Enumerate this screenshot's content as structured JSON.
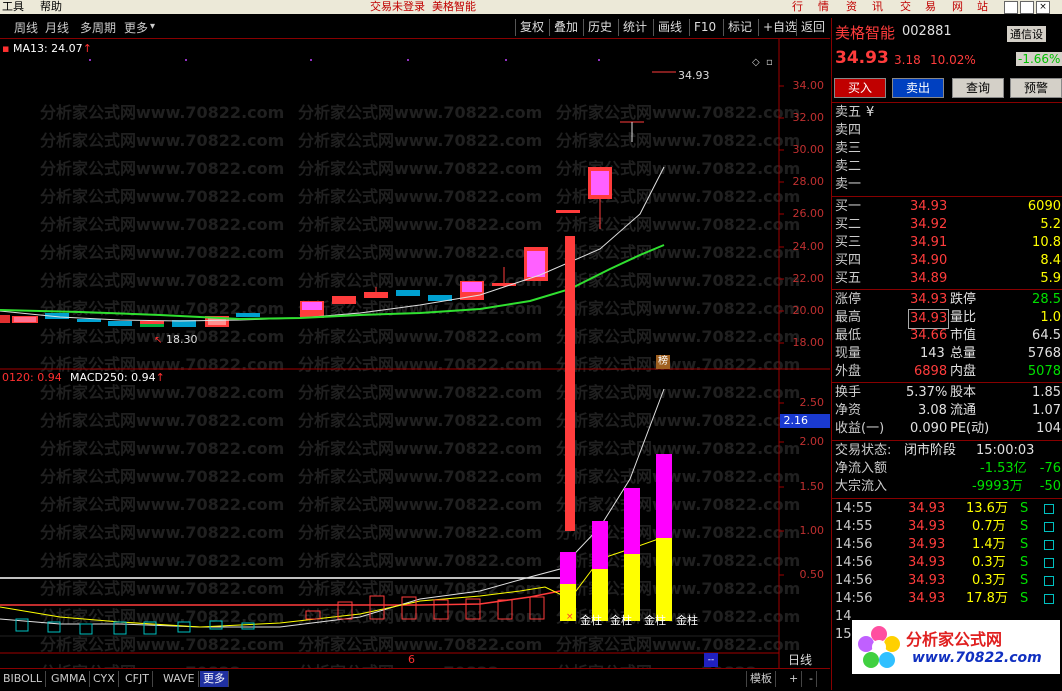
{
  "menubar": {
    "items": [
      "工具",
      "帮助"
    ],
    "status": "交易未登录",
    "stock_title": "美格智能",
    "right_items": [
      "行",
      "情",
      "资",
      "讯",
      "交",
      "易",
      "网",
      "站"
    ]
  },
  "toolbar": {
    "left": [
      "周线",
      "月线",
      "多周期",
      "更多"
    ],
    "right": [
      "复权",
      "叠加",
      "历史",
      "统计",
      "画线",
      "F10",
      "标记",
      "+自选",
      "返回"
    ]
  },
  "main_chart": {
    "ma_label": "MA13: 24.07",
    "high_label": "34.93",
    "low_label": "18.30",
    "y_ticks": [
      "34.00",
      "32.00",
      "30.00",
      "28.00",
      "26.00",
      "24.00",
      "22.00",
      "20.00",
      "18.00"
    ],
    "badge": "榜"
  },
  "sub_chart": {
    "left_label": "0120: 0.94",
    "macd_label": "MACD250: 0.94",
    "y_ticks": [
      "2.50",
      "2.00",
      "1.50",
      "1.00",
      "0.50"
    ],
    "cursor_value": "2.16",
    "gold_labels": [
      "金柱",
      "金柱",
      "金柱",
      "金柱"
    ],
    "num_marker": "6"
  },
  "watermark": "分析家公式网www.70822.com",
  "bottom_tabs": [
    "BIBOLL",
    "GMMA",
    "CYX",
    "CFJT",
    "WAVE",
    "更多"
  ],
  "bottom_right": {
    "mode": "模板",
    "plus": "+",
    "minus": "-",
    "period": "日线"
  },
  "quote": {
    "name": "美格智能",
    "code": "002881",
    "notice": "通信设",
    "notice_pct": "-1.66%",
    "price": "34.93",
    "change": "3.18",
    "pct": "10.02%",
    "buttons": [
      "买入",
      "卖出",
      "查询",
      "预警"
    ],
    "sell_levels": [
      {
        "label": "卖五",
        "sym": "¥"
      },
      {
        "label": "卖四",
        "sym": ""
      },
      {
        "label": "卖三",
        "sym": ""
      },
      {
        "label": "卖二",
        "sym": ""
      },
      {
        "label": "卖一",
        "sym": ""
      }
    ],
    "buy_levels": [
      {
        "label": "买一",
        "price": "34.93",
        "vol": "6090"
      },
      {
        "label": "买二",
        "price": "34.92",
        "vol": "5.2"
      },
      {
        "label": "买三",
        "price": "34.91",
        "vol": "10.8"
      },
      {
        "label": "买四",
        "price": "34.90",
        "vol": "8.4"
      },
      {
        "label": "买五",
        "price": "34.89",
        "vol": "5.9"
      }
    ],
    "stats": [
      {
        "l1": "涨停",
        "v1": "34.93",
        "l2": "跌停",
        "v2": "28.5"
      },
      {
        "l1": "最高",
        "v1": "34.93",
        "l2": "量比",
        "v2": "1.0"
      },
      {
        "l1": "最低",
        "v1": "34.66",
        "l2": "市值",
        "v2": "64.5"
      },
      {
        "l1": "现量",
        "v1": "143",
        "l2": "总量",
        "v2": "5768"
      },
      {
        "l1": "外盘",
        "v1": "6898",
        "l2": "内盘",
        "v2": "5078"
      }
    ],
    "stats2": [
      {
        "l1": "换手",
        "v1": "5.37%",
        "l2": "股本",
        "v2": "1.85"
      },
      {
        "l1": "净资",
        "v1": "3.08",
        "l2": "流通",
        "v2": "1.07"
      },
      {
        "l1": "收益(一)",
        "v1": "0.090",
        "l2": "PE(动)",
        "v2": "104"
      }
    ],
    "trade_status_label": "交易状态:",
    "trade_status": "闭市阶段",
    "trade_time": "15:00:03",
    "netflow_label": "净流入额",
    "netflow": "-1.53亿",
    "netflow_pct": "-76",
    "block_label": "大宗流入",
    "block": "-9993万",
    "block_pct": "-50",
    "ticks": [
      {
        "t": "14:55",
        "p": "34.93",
        "v": "13.6万",
        "s": "S"
      },
      {
        "t": "14:55",
        "p": "34.93",
        "v": "0.7万",
        "s": "S"
      },
      {
        "t": "14:56",
        "p": "34.93",
        "v": "1.4万",
        "s": "S"
      },
      {
        "t": "14:56",
        "p": "34.93",
        "v": "0.3万",
        "s": "S"
      },
      {
        "t": "14:56",
        "p": "34.93",
        "v": "0.3万",
        "s": "S"
      },
      {
        "t": "14:56",
        "p": "34.93",
        "v": "17.8万",
        "s": "S"
      },
      {
        "t": "14",
        "p": "",
        "v": "",
        "s": ""
      },
      {
        "t": "15",
        "p": "",
        "v": "",
        "s": ""
      }
    ],
    "logo_text": "分析家公式网",
    "logo_url": "www.70822.com"
  },
  "colors": {
    "up": "#ff3c3c",
    "down": "#00c0c0",
    "ma_green": "#30e030",
    "gold": "#ffff00",
    "magenta": "#ff00ff"
  }
}
